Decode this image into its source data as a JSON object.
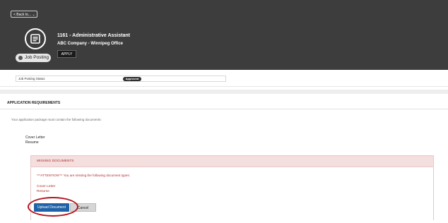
{
  "header": {
    "back_label": "< Back to...  ⌄",
    "job_title": "1161 - Administrative Assistant",
    "company": "ABC Company - Winnipeg Office",
    "apply_label": "APPLY",
    "badge_label": "Job Posting"
  },
  "status": {
    "label": "Job Posting Status",
    "value": "Approved"
  },
  "requirements": {
    "title": "APPLICATION REQUIREMENTS",
    "intro": "Your application package must contain the following documents:",
    "documents": [
      "Cover Letter",
      "Resume"
    ]
  },
  "missing": {
    "title": "MISSING DOCUMENTS",
    "attention": "***ATTENTION*** You are missing the following document types:",
    "documents": [
      "Cover Letter",
      "Resume"
    ]
  },
  "actions": {
    "upload_label": "Upload Document",
    "cancel_label": "Cancel"
  },
  "colors": {
    "header_bg": "#3d3d3d",
    "primary": "#1f62a8",
    "error": "#b02d2d",
    "highlight": "#b3131d"
  },
  "icons": {
    "job": "document-icon",
    "badge": "status-dot-icon"
  }
}
